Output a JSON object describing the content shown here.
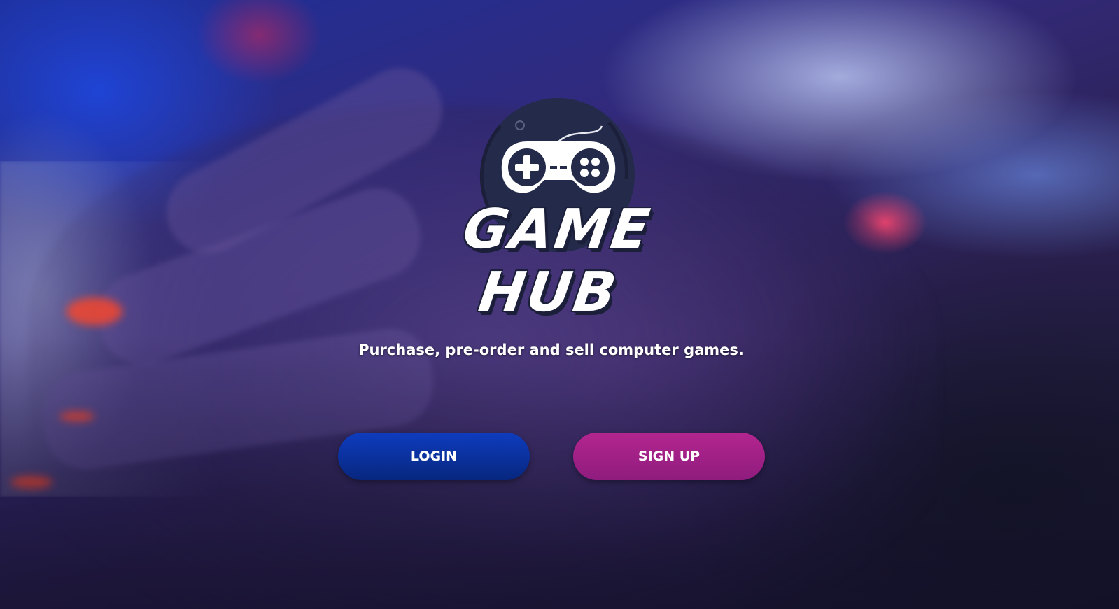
{
  "brand": {
    "logo_text": "GAME HUB",
    "logo_icon": "gamepad-icon"
  },
  "tagline": "Purchase, pre-order and sell computer games.",
  "actions": {
    "login_label": "LOGIN",
    "signup_label": "SIGN UP"
  },
  "colors": {
    "login_button": "#0a32a0",
    "signup_button": "#a02086",
    "logo_badge": "#232a4a"
  }
}
